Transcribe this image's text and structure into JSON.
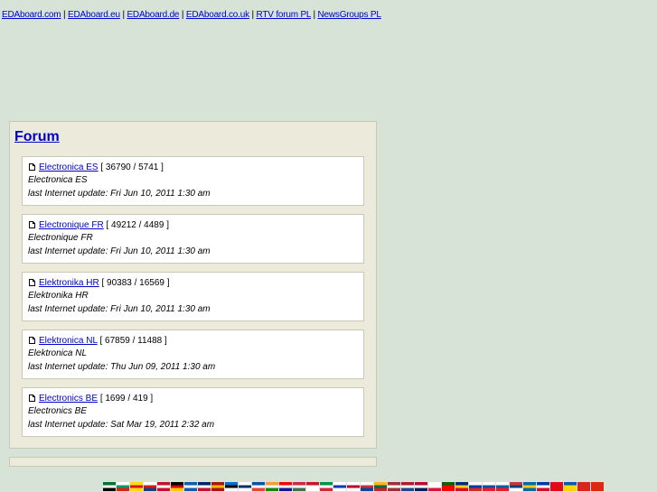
{
  "toplinks": [
    {
      "label": "EDAboard.com"
    },
    {
      "label": "EDAboard.eu"
    },
    {
      "label": "EDAboard.de"
    },
    {
      "label": "EDAboard.co.uk"
    },
    {
      "label": "RTV forum PL"
    },
    {
      "label": "NewsGroups PL"
    }
  ],
  "separator": "|",
  "forum": {
    "title": "Forum",
    "items": [
      {
        "link": "Electronica ES",
        "counts": "[ 36790 / 5741 ]",
        "description": "Electronica ES",
        "update": "last Internet update: Fri Jun 10, 2011 1:30 am"
      },
      {
        "link": "Electronique FR",
        "counts": "[ 49212 / 4489 ]",
        "description": "Electronique FR",
        "update": "last Internet update: Fri Jun 10, 2011 1:30 am"
      },
      {
        "link": "Elektronika HR",
        "counts": "[ 90383 / 16569 ]",
        "description": "Elektronika HR",
        "update": "last Internet update: Fri Jun 10, 2011 1:30 am"
      },
      {
        "link": "Elektronica NL",
        "counts": "[ 67859 / 11488 ]",
        "description": "Elektronica NL",
        "update": "last Internet update: Thu Jun 09, 2011 1:30 am"
      },
      {
        "link": "Electronics BE",
        "counts": "[ 1699 / 419 ]",
        "description": "Electronics BE",
        "update": "last Internet update: Sat Mar 19, 2011 2:32 am"
      }
    ]
  },
  "flags": [
    {
      "name": "ae-flag-icon",
      "colors": [
        "#00732f",
        "#ffffff",
        "#000000"
      ]
    },
    {
      "name": "bg-flag-icon",
      "colors": [
        "#ffffff",
        "#00966e",
        "#d62612"
      ]
    },
    {
      "name": "ca-flag-icon",
      "colors": [
        "#fcdd09",
        "#da121a",
        "#fcdd09"
      ]
    },
    {
      "name": "cz-flag-icon",
      "colors": [
        "#ffffff",
        "#d7141a",
        "#11457e"
      ]
    },
    {
      "name": "dk-flag-icon",
      "colors": [
        "#c8102e",
        "#ffffff",
        "#c8102e"
      ]
    },
    {
      "name": "de-flag-icon",
      "colors": [
        "#000000",
        "#dd0000",
        "#ffce00"
      ]
    },
    {
      "name": "gr-flag-icon",
      "colors": [
        "#0d5eaf",
        "#ffffff",
        "#0d5eaf"
      ]
    },
    {
      "name": "en-flag-icon",
      "colors": [
        "#012169",
        "#ffffff",
        "#c8102e"
      ]
    },
    {
      "name": "es-flag-icon",
      "colors": [
        "#aa151b",
        "#f1bf00",
        "#aa151b"
      ]
    },
    {
      "name": "ee-flag-icon",
      "colors": [
        "#0072ce",
        "#000000",
        "#ffffff"
      ]
    },
    {
      "name": "fi-flag-icon",
      "colors": [
        "#ffffff",
        "#002f6c",
        "#ffffff"
      ]
    },
    {
      "name": "fr-flag-icon",
      "colors": [
        "#0055a4",
        "#ffffff",
        "#ef4135"
      ]
    },
    {
      "name": "in-flag-icon",
      "colors": [
        "#ff9933",
        "#ffffff",
        "#138808"
      ]
    },
    {
      "name": "hr-flag-icon",
      "colors": [
        "#ff0000",
        "#ffffff",
        "#171796"
      ]
    },
    {
      "name": "hu-flag-icon",
      "colors": [
        "#cd2a3e",
        "#ffffff",
        "#436f4d"
      ]
    },
    {
      "name": "id-flag-icon",
      "colors": [
        "#ce1126",
        "#ffffff",
        "#ffffff"
      ]
    },
    {
      "name": "it-flag-icon",
      "colors": [
        "#009246",
        "#ffffff",
        "#ce2b37"
      ]
    },
    {
      "name": "il-flag-icon",
      "colors": [
        "#ffffff",
        "#0038b8",
        "#ffffff"
      ]
    },
    {
      "name": "jp-flag-icon",
      "colors": [
        "#ffffff",
        "#bc002d",
        "#ffffff"
      ]
    },
    {
      "name": "kr-flag-icon",
      "colors": [
        "#ffffff",
        "#cd2e3a",
        "#0047a0"
      ]
    },
    {
      "name": "lt-flag-icon",
      "colors": [
        "#fdb913",
        "#006a44",
        "#c1272d"
      ]
    },
    {
      "name": "lv-flag-icon",
      "colors": [
        "#9e3039",
        "#ffffff",
        "#9e3039"
      ]
    },
    {
      "name": "nl-flag-icon",
      "colors": [
        "#ae1c28",
        "#ffffff",
        "#21468b"
      ]
    },
    {
      "name": "no-flag-icon",
      "colors": [
        "#ba0c2f",
        "#ffffff",
        "#00205b"
      ]
    },
    {
      "name": "pl-flag-icon",
      "colors": [
        "#ffffff",
        "#ffffff",
        "#dc143c"
      ]
    },
    {
      "name": "pt-flag-icon",
      "colors": [
        "#006600",
        "#ff0000",
        "#ff0000"
      ]
    },
    {
      "name": "ro-flag-icon",
      "colors": [
        "#002b7f",
        "#fcd116",
        "#ce1126"
      ]
    },
    {
      "name": "ru-flag-icon",
      "colors": [
        "#ffffff",
        "#0039a6",
        "#d52b1e"
      ]
    },
    {
      "name": "sk-flag-icon",
      "colors": [
        "#ffffff",
        "#0b4ea2",
        "#ee1c25"
      ]
    },
    {
      "name": "si-flag-icon",
      "colors": [
        "#ffffff",
        "#005da4",
        "#ed1c24"
      ]
    },
    {
      "name": "rs-flag-icon",
      "colors": [
        "#c6363c",
        "#0c4076",
        "#ffffff"
      ]
    },
    {
      "name": "se-flag-icon",
      "colors": [
        "#006aa7",
        "#fecc02",
        "#006aa7"
      ]
    },
    {
      "name": "ph-flag-icon",
      "colors": [
        "#0038a8",
        "#ffffff",
        "#ce1126"
      ]
    },
    {
      "name": "tr-flag-icon",
      "colors": [
        "#e30a17",
        "#e30a17",
        "#e30a17"
      ]
    },
    {
      "name": "ua-flag-icon",
      "colors": [
        "#0057b7",
        "#ffd700",
        "#ffd700"
      ]
    },
    {
      "name": "vn-flag-icon",
      "colors": [
        "#da251d",
        "#da251d",
        "#da251d"
      ]
    },
    {
      "name": "cn-flag-icon",
      "colors": [
        "#de2910",
        "#de2910",
        "#de2910"
      ]
    }
  ]
}
